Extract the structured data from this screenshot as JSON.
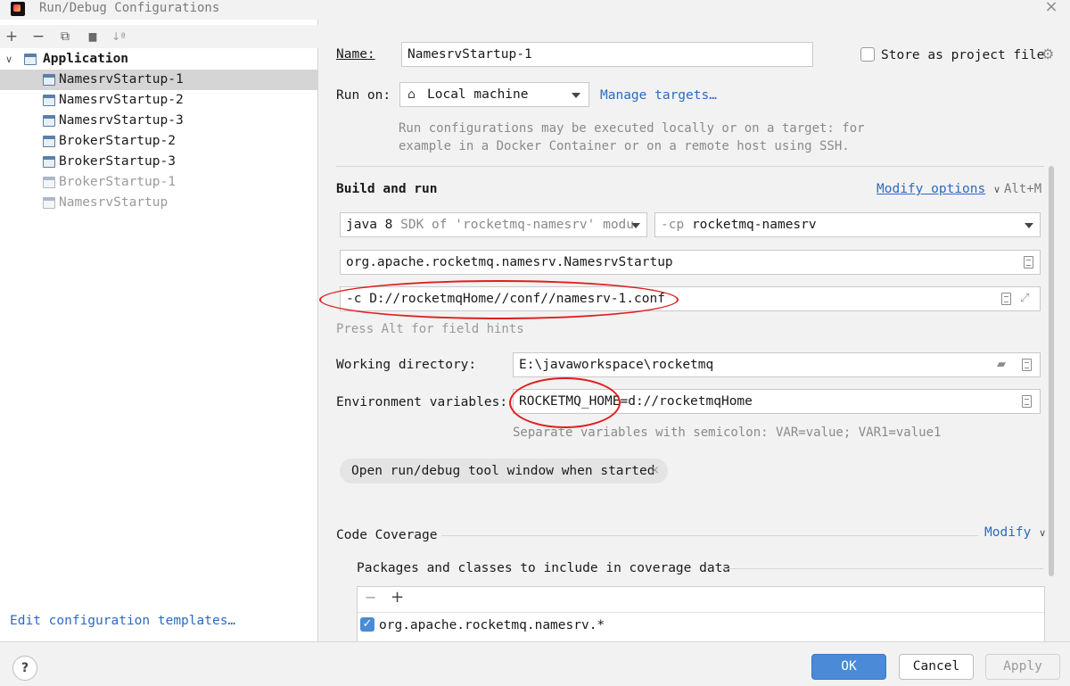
{
  "window": {
    "title": "Run/Debug Configurations",
    "close": "×"
  },
  "toolbar": {
    "add": "+",
    "remove": "−",
    "copy": "⧉",
    "folder": "▆",
    "sort": "↓ª"
  },
  "tree": {
    "group": "Application",
    "items": [
      {
        "label": "NamesrvStartup-1",
        "selected": true,
        "faded": false
      },
      {
        "label": "NamesrvStartup-2",
        "selected": false,
        "faded": false
      },
      {
        "label": "NamesrvStartup-3",
        "selected": false,
        "faded": false
      },
      {
        "label": "BrokerStartup-2",
        "selected": false,
        "faded": false
      },
      {
        "label": "BrokerStartup-3",
        "selected": false,
        "faded": false
      },
      {
        "label": "BrokerStartup-1",
        "selected": false,
        "faded": true
      },
      {
        "label": "NamesrvStartup",
        "selected": false,
        "faded": true
      }
    ],
    "edit_templates": "Edit configuration templates…"
  },
  "form": {
    "name_label": "Name:",
    "name_value": "NamesrvStartup-1",
    "store_project": "Store as project file",
    "run_on_label": "Run on:",
    "run_on_value": "Local machine",
    "manage_targets": "Manage targets…",
    "run_on_hint_1": "Run configurations may be executed locally or on a target: for",
    "run_on_hint_2": "example in a Docker Container or on a remote host using SSH.",
    "build_and_run": "Build and run",
    "modify_options": "Modify options",
    "modify_shortcut": "Alt+M",
    "sdk_java": "java 8",
    "sdk_desc": "SDK of 'rocketmq-namesrv' modu",
    "cp_prefix": "-cp",
    "cp_value": "rocketmq-namesrv",
    "main_class": "org.apache.rocketmq.namesrv.NamesrvStartup",
    "program_args": "-c D://rocketmqHome//conf//namesrv-1.conf",
    "field_hints": "Press Alt for field hints",
    "working_dir_label": "Working directory:",
    "working_dir_value": "E:\\javaworkspace\\rocketmq",
    "env_label": "Environment variables:",
    "env_value": "ROCKETMQ_HOME=d://rocketmqHome",
    "env_hint": "Separate variables with semicolon: VAR=value; VAR1=value1",
    "tool_window_chip": "Open run/debug tool window when started",
    "chip_close": "×",
    "code_coverage": "Code Coverage",
    "modify": "Modify",
    "packages_label": "Packages and classes to include in coverage data",
    "coverage_minus": "−",
    "coverage_plus": "+",
    "coverage_package": "org.apache.rocketmq.namesrv.*"
  },
  "buttons": {
    "help": "?",
    "ok": "OK",
    "cancel": "Cancel",
    "apply": "Apply"
  },
  "colors": {
    "accent": "#4a8ad7",
    "link": "#2a6bc2",
    "annotation": "#e01e1e"
  }
}
